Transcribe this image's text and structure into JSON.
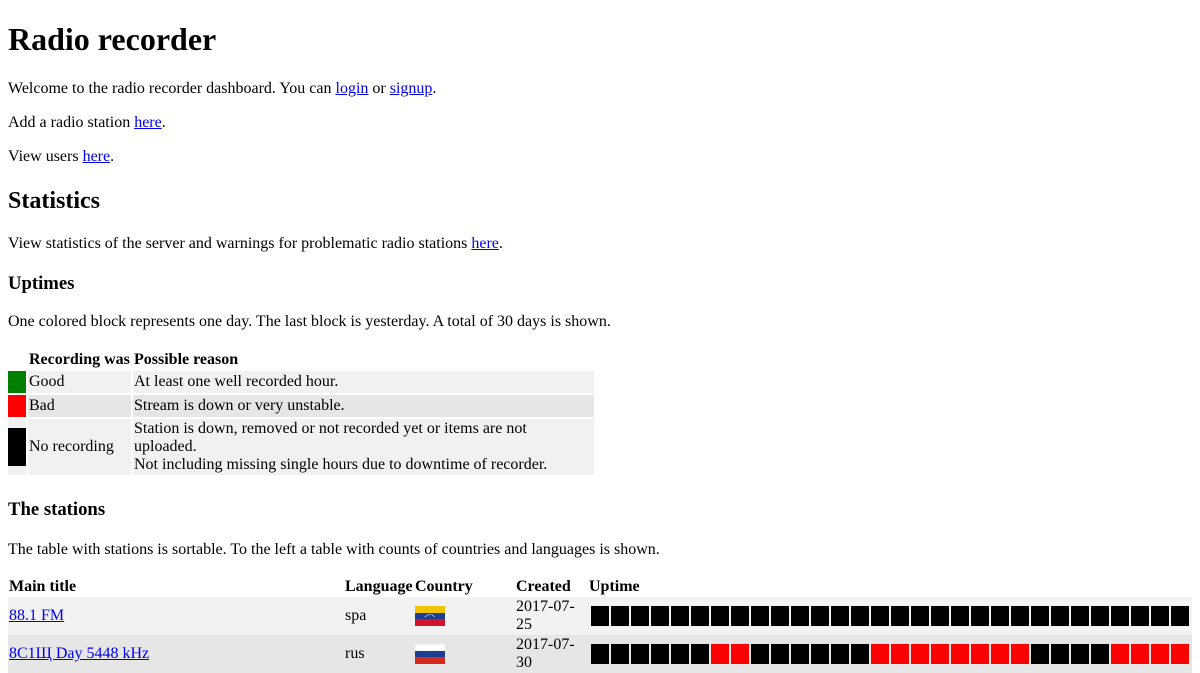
{
  "page": {
    "title": "Radio recorder",
    "welcome_prefix": "Welcome to the radio recorder dashboard. You can ",
    "login_link": "login",
    "or_text": " or ",
    "signup_link": "signup",
    "period": ".",
    "add_prefix": "Add a radio station ",
    "add_link": "here",
    "users_prefix": "View users ",
    "users_link": "here"
  },
  "statistics": {
    "heading": "Statistics",
    "text_prefix": "View statistics of the server and warnings for problematic radio stations ",
    "link": "here"
  },
  "uptimes": {
    "heading": "Uptimes",
    "description": "One colored block represents one day. The last block is yesterday. A total of 30 days is shown.",
    "legend": {
      "header_recording": "Recording was",
      "header_reason": "Possible reason",
      "rows": [
        {
          "label": "Good",
          "reason_line1": "At least one well recorded hour.",
          "reason_line2": "",
          "color": "#008000"
        },
        {
          "label": "Bad",
          "reason_line1": "Stream is down or very unstable.",
          "reason_line2": "",
          "color": "#ff0000"
        },
        {
          "label": "No recording",
          "reason_line1": "Station is down, removed or not recorded yet or items are not uploaded.",
          "reason_line2": "Not including missing single hours due to downtime of recorder.",
          "color": "#000000"
        }
      ]
    }
  },
  "stations_section": {
    "heading": "The stations",
    "description": "The table with stations is sortable. To the left a table with counts of countries and languages is shown.",
    "columns": {
      "main_title": "Main title",
      "language": "Language",
      "country": "Country",
      "created": "Created",
      "uptime": "Uptime"
    },
    "rows": [
      {
        "title": "88.1 FM",
        "language": "spa",
        "country_flag": "venezuela-flag",
        "created_line1": "2017-07-",
        "created_line2": "25",
        "uptime": [
          "none",
          "none",
          "none",
          "none",
          "none",
          "none",
          "none",
          "none",
          "none",
          "none",
          "none",
          "none",
          "none",
          "none",
          "none",
          "none",
          "none",
          "none",
          "none",
          "none",
          "none",
          "none",
          "none",
          "none",
          "none",
          "none",
          "none",
          "none",
          "none",
          "none"
        ]
      },
      {
        "title": "8С1Щ Day 5448 kHz",
        "language": "rus",
        "country_flag": "russia-flag",
        "created_line1": "2017-07-",
        "created_line2": "30",
        "uptime": [
          "none",
          "none",
          "none",
          "none",
          "none",
          "none",
          "bad",
          "bad",
          "none",
          "none",
          "none",
          "none",
          "none",
          "none",
          "bad",
          "bad",
          "bad",
          "bad",
          "bad",
          "bad",
          "bad",
          "bad",
          "none",
          "none",
          "none",
          "none",
          "bad",
          "bad",
          "bad",
          "bad"
        ]
      }
    ]
  }
}
